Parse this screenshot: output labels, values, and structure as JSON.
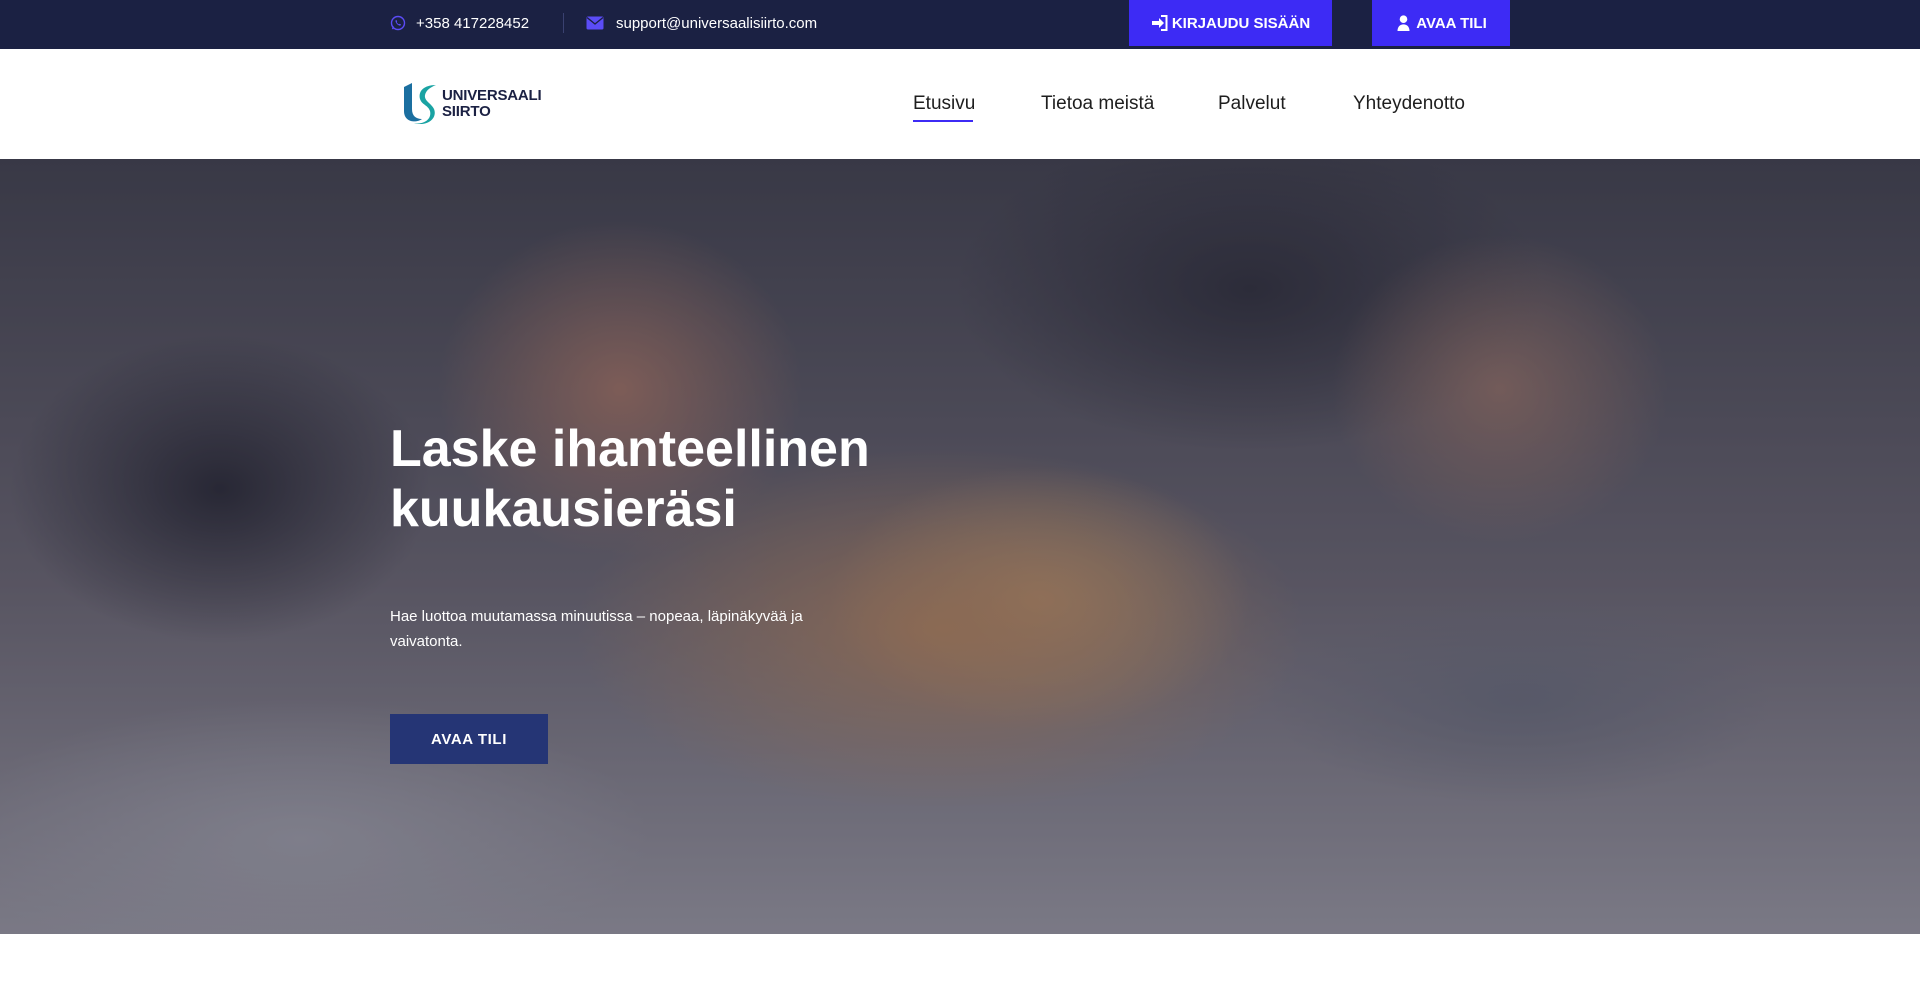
{
  "topbar": {
    "phone": "+358 417228452",
    "email": "support@universaalisiirto.com",
    "login_label": "KIRJAUDU SISÄÄN",
    "open_account_label": "AVAA TILI",
    "icons": {
      "phone": "whatsapp-icon",
      "email": "envelope-icon",
      "login": "sign-in-icon",
      "open_account": "user-icon"
    },
    "accent_color": "#3d2bf5",
    "background_color": "#1b2143"
  },
  "header": {
    "logo": {
      "line1": "UNIVERSAALI",
      "line2": "SIIRTO"
    },
    "nav": [
      {
        "label": "Etusivu",
        "active": true
      },
      {
        "label": "Tietoa meistä",
        "active": false
      },
      {
        "label": "Palvelut",
        "active": false
      },
      {
        "label": "Yhteydenotto",
        "active": false
      }
    ]
  },
  "hero": {
    "title_line1": "Laske ihanteellinen",
    "title_line2": "kuukausieräsi",
    "subtitle": "Hae luottoa muutamassa minuutissa – nopeaa, läpinäkyvää ja vaivatonta.",
    "cta_label": "AVAA TILI",
    "cta_color": "#253575"
  }
}
